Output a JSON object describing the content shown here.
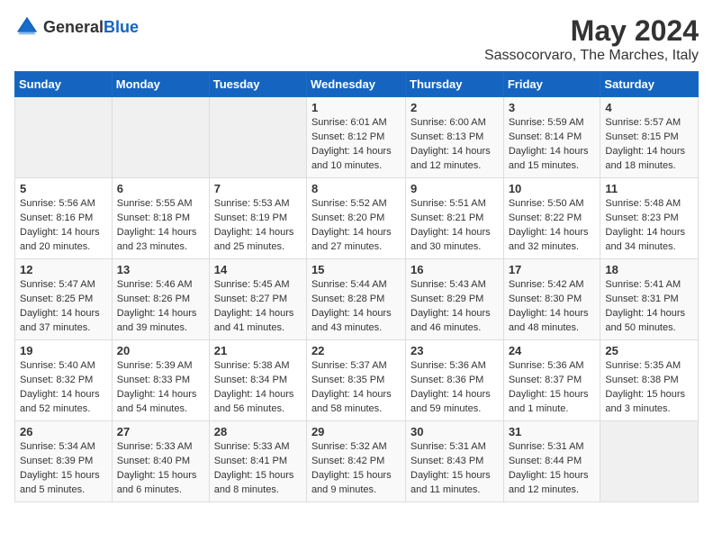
{
  "header": {
    "logo_general": "General",
    "logo_blue": "Blue",
    "month": "May 2024",
    "location": "Sassocorvaro, The Marches, Italy"
  },
  "days_of_week": [
    "Sunday",
    "Monday",
    "Tuesday",
    "Wednesday",
    "Thursday",
    "Friday",
    "Saturday"
  ],
  "weeks": [
    [
      {
        "day": "",
        "content": ""
      },
      {
        "day": "",
        "content": ""
      },
      {
        "day": "",
        "content": ""
      },
      {
        "day": "1",
        "content": "Sunrise: 6:01 AM\nSunset: 8:12 PM\nDaylight: 14 hours\nand 10 minutes."
      },
      {
        "day": "2",
        "content": "Sunrise: 6:00 AM\nSunset: 8:13 PM\nDaylight: 14 hours\nand 12 minutes."
      },
      {
        "day": "3",
        "content": "Sunrise: 5:59 AM\nSunset: 8:14 PM\nDaylight: 14 hours\nand 15 minutes."
      },
      {
        "day": "4",
        "content": "Sunrise: 5:57 AM\nSunset: 8:15 PM\nDaylight: 14 hours\nand 18 minutes."
      }
    ],
    [
      {
        "day": "5",
        "content": "Sunrise: 5:56 AM\nSunset: 8:16 PM\nDaylight: 14 hours\nand 20 minutes."
      },
      {
        "day": "6",
        "content": "Sunrise: 5:55 AM\nSunset: 8:18 PM\nDaylight: 14 hours\nand 23 minutes."
      },
      {
        "day": "7",
        "content": "Sunrise: 5:53 AM\nSunset: 8:19 PM\nDaylight: 14 hours\nand 25 minutes."
      },
      {
        "day": "8",
        "content": "Sunrise: 5:52 AM\nSunset: 8:20 PM\nDaylight: 14 hours\nand 27 minutes."
      },
      {
        "day": "9",
        "content": "Sunrise: 5:51 AM\nSunset: 8:21 PM\nDaylight: 14 hours\nand 30 minutes."
      },
      {
        "day": "10",
        "content": "Sunrise: 5:50 AM\nSunset: 8:22 PM\nDaylight: 14 hours\nand 32 minutes."
      },
      {
        "day": "11",
        "content": "Sunrise: 5:48 AM\nSunset: 8:23 PM\nDaylight: 14 hours\nand 34 minutes."
      }
    ],
    [
      {
        "day": "12",
        "content": "Sunrise: 5:47 AM\nSunset: 8:25 PM\nDaylight: 14 hours\nand 37 minutes."
      },
      {
        "day": "13",
        "content": "Sunrise: 5:46 AM\nSunset: 8:26 PM\nDaylight: 14 hours\nand 39 minutes."
      },
      {
        "day": "14",
        "content": "Sunrise: 5:45 AM\nSunset: 8:27 PM\nDaylight: 14 hours\nand 41 minutes."
      },
      {
        "day": "15",
        "content": "Sunrise: 5:44 AM\nSunset: 8:28 PM\nDaylight: 14 hours\nand 43 minutes."
      },
      {
        "day": "16",
        "content": "Sunrise: 5:43 AM\nSunset: 8:29 PM\nDaylight: 14 hours\nand 46 minutes."
      },
      {
        "day": "17",
        "content": "Sunrise: 5:42 AM\nSunset: 8:30 PM\nDaylight: 14 hours\nand 48 minutes."
      },
      {
        "day": "18",
        "content": "Sunrise: 5:41 AM\nSunset: 8:31 PM\nDaylight: 14 hours\nand 50 minutes."
      }
    ],
    [
      {
        "day": "19",
        "content": "Sunrise: 5:40 AM\nSunset: 8:32 PM\nDaylight: 14 hours\nand 52 minutes."
      },
      {
        "day": "20",
        "content": "Sunrise: 5:39 AM\nSunset: 8:33 PM\nDaylight: 14 hours\nand 54 minutes."
      },
      {
        "day": "21",
        "content": "Sunrise: 5:38 AM\nSunset: 8:34 PM\nDaylight: 14 hours\nand 56 minutes."
      },
      {
        "day": "22",
        "content": "Sunrise: 5:37 AM\nSunset: 8:35 PM\nDaylight: 14 hours\nand 58 minutes."
      },
      {
        "day": "23",
        "content": "Sunrise: 5:36 AM\nSunset: 8:36 PM\nDaylight: 14 hours\nand 59 minutes."
      },
      {
        "day": "24",
        "content": "Sunrise: 5:36 AM\nSunset: 8:37 PM\nDaylight: 15 hours\nand 1 minute."
      },
      {
        "day": "25",
        "content": "Sunrise: 5:35 AM\nSunset: 8:38 PM\nDaylight: 15 hours\nand 3 minutes."
      }
    ],
    [
      {
        "day": "26",
        "content": "Sunrise: 5:34 AM\nSunset: 8:39 PM\nDaylight: 15 hours\nand 5 minutes."
      },
      {
        "day": "27",
        "content": "Sunrise: 5:33 AM\nSunset: 8:40 PM\nDaylight: 15 hours\nand 6 minutes."
      },
      {
        "day": "28",
        "content": "Sunrise: 5:33 AM\nSunset: 8:41 PM\nDaylight: 15 hours\nand 8 minutes."
      },
      {
        "day": "29",
        "content": "Sunrise: 5:32 AM\nSunset: 8:42 PM\nDaylight: 15 hours\nand 9 minutes."
      },
      {
        "day": "30",
        "content": "Sunrise: 5:31 AM\nSunset: 8:43 PM\nDaylight: 15 hours\nand 11 minutes."
      },
      {
        "day": "31",
        "content": "Sunrise: 5:31 AM\nSunset: 8:44 PM\nDaylight: 15 hours\nand 12 minutes."
      },
      {
        "day": "",
        "content": ""
      }
    ]
  ]
}
